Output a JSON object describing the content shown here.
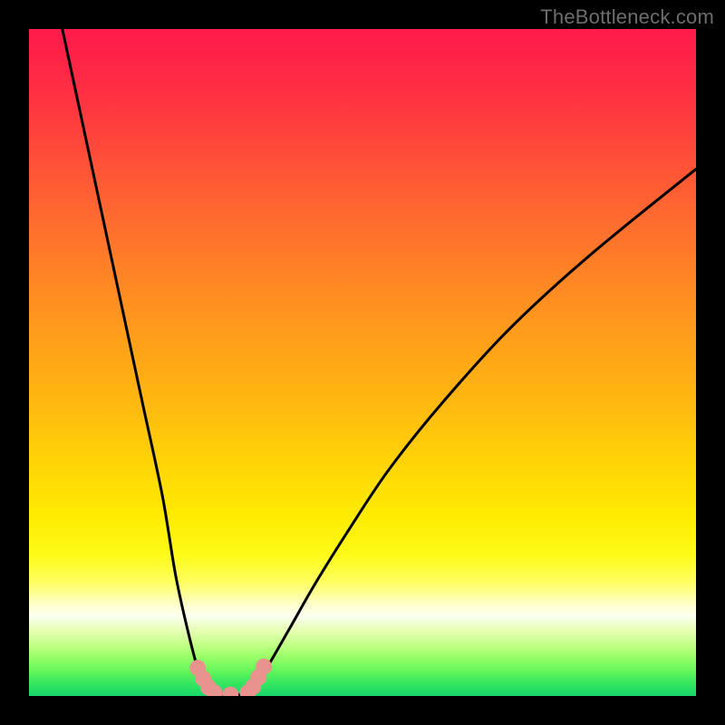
{
  "watermark": "TheBottleneck.com",
  "colors": {
    "frame": "#000000",
    "curve": "#000000",
    "dots": "#e8938e"
  },
  "chart_data": {
    "type": "line",
    "title": "",
    "xlabel": "",
    "ylabel": "",
    "xlim": [
      0,
      100
    ],
    "ylim": [
      0,
      100
    ],
    "grid": false,
    "legend": false,
    "note": "V-shaped bottleneck curve; y≈100 means worst (top/red), y≈0 means best (bottom/green). Values estimated from pixel positions.",
    "series": [
      {
        "name": "left-branch",
        "x": [
          5,
          8,
          11,
          14,
          17,
          20,
          22,
          24,
          25.5,
          26.7,
          27.8
        ],
        "y": [
          100,
          86,
          72,
          58,
          44,
          30,
          18,
          9,
          3.5,
          1.2,
          0.4
        ]
      },
      {
        "name": "valley",
        "x": [
          27.8,
          29,
          30.2,
          31.5,
          32.8
        ],
        "y": [
          0.4,
          0.2,
          0.2,
          0.2,
          0.4
        ]
      },
      {
        "name": "right-branch",
        "x": [
          32.8,
          34,
          36,
          39,
          43,
          48,
          54,
          62,
          72,
          84,
          100
        ],
        "y": [
          0.4,
          1.6,
          4.8,
          10,
          17,
          25,
          34,
          44,
          55,
          66,
          79
        ]
      }
    ],
    "markers": [
      {
        "x": 25.3,
        "y": 4.2
      },
      {
        "x": 26.1,
        "y": 2.6
      },
      {
        "x": 26.9,
        "y": 1.3
      },
      {
        "x": 27.8,
        "y": 0.5
      },
      {
        "x": 30.2,
        "y": 0.2
      },
      {
        "x": 32.8,
        "y": 0.5
      },
      {
        "x": 33.6,
        "y": 1.4
      },
      {
        "x": 34.4,
        "y": 2.8
      },
      {
        "x": 35.2,
        "y": 4.4
      }
    ]
  }
}
